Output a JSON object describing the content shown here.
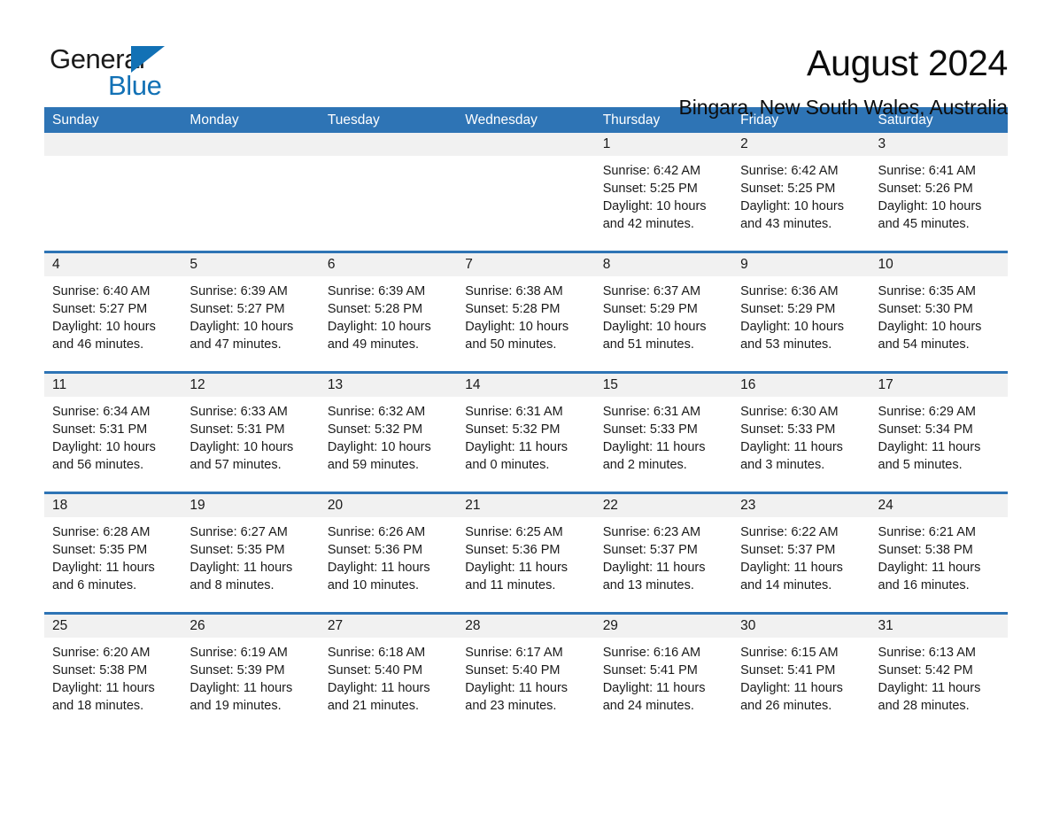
{
  "brand": {
    "word_one": "General",
    "word_two": "Blue",
    "triangle_color": "#1271b5"
  },
  "header": {
    "month_title": "August 2024",
    "location": "Bingara, New South Wales, Australia",
    "accent_color": "#2e74b5"
  },
  "calendar": {
    "weekdays": [
      "Sunday",
      "Monday",
      "Tuesday",
      "Wednesday",
      "Thursday",
      "Friday",
      "Saturday"
    ],
    "weeks": [
      [
        {
          "day": "",
          "lines": []
        },
        {
          "day": "",
          "lines": []
        },
        {
          "day": "",
          "lines": []
        },
        {
          "day": "",
          "lines": []
        },
        {
          "day": "1",
          "lines": [
            "Sunrise: 6:42 AM",
            "Sunset: 5:25 PM",
            "Daylight: 10 hours",
            "and 42 minutes."
          ]
        },
        {
          "day": "2",
          "lines": [
            "Sunrise: 6:42 AM",
            "Sunset: 5:25 PM",
            "Daylight: 10 hours",
            "and 43 minutes."
          ]
        },
        {
          "day": "3",
          "lines": [
            "Sunrise: 6:41 AM",
            "Sunset: 5:26 PM",
            "Daylight: 10 hours",
            "and 45 minutes."
          ]
        }
      ],
      [
        {
          "day": "4",
          "lines": [
            "Sunrise: 6:40 AM",
            "Sunset: 5:27 PM",
            "Daylight: 10 hours",
            "and 46 minutes."
          ]
        },
        {
          "day": "5",
          "lines": [
            "Sunrise: 6:39 AM",
            "Sunset: 5:27 PM",
            "Daylight: 10 hours",
            "and 47 minutes."
          ]
        },
        {
          "day": "6",
          "lines": [
            "Sunrise: 6:39 AM",
            "Sunset: 5:28 PM",
            "Daylight: 10 hours",
            "and 49 minutes."
          ]
        },
        {
          "day": "7",
          "lines": [
            "Sunrise: 6:38 AM",
            "Sunset: 5:28 PM",
            "Daylight: 10 hours",
            "and 50 minutes."
          ]
        },
        {
          "day": "8",
          "lines": [
            "Sunrise: 6:37 AM",
            "Sunset: 5:29 PM",
            "Daylight: 10 hours",
            "and 51 minutes."
          ]
        },
        {
          "day": "9",
          "lines": [
            "Sunrise: 6:36 AM",
            "Sunset: 5:29 PM",
            "Daylight: 10 hours",
            "and 53 minutes."
          ]
        },
        {
          "day": "10",
          "lines": [
            "Sunrise: 6:35 AM",
            "Sunset: 5:30 PM",
            "Daylight: 10 hours",
            "and 54 minutes."
          ]
        }
      ],
      [
        {
          "day": "11",
          "lines": [
            "Sunrise: 6:34 AM",
            "Sunset: 5:31 PM",
            "Daylight: 10 hours",
            "and 56 minutes."
          ]
        },
        {
          "day": "12",
          "lines": [
            "Sunrise: 6:33 AM",
            "Sunset: 5:31 PM",
            "Daylight: 10 hours",
            "and 57 minutes."
          ]
        },
        {
          "day": "13",
          "lines": [
            "Sunrise: 6:32 AM",
            "Sunset: 5:32 PM",
            "Daylight: 10 hours",
            "and 59 minutes."
          ]
        },
        {
          "day": "14",
          "lines": [
            "Sunrise: 6:31 AM",
            "Sunset: 5:32 PM",
            "Daylight: 11 hours",
            "and 0 minutes."
          ]
        },
        {
          "day": "15",
          "lines": [
            "Sunrise: 6:31 AM",
            "Sunset: 5:33 PM",
            "Daylight: 11 hours",
            "and 2 minutes."
          ]
        },
        {
          "day": "16",
          "lines": [
            "Sunrise: 6:30 AM",
            "Sunset: 5:33 PM",
            "Daylight: 11 hours",
            "and 3 minutes."
          ]
        },
        {
          "day": "17",
          "lines": [
            "Sunrise: 6:29 AM",
            "Sunset: 5:34 PM",
            "Daylight: 11 hours",
            "and 5 minutes."
          ]
        }
      ],
      [
        {
          "day": "18",
          "lines": [
            "Sunrise: 6:28 AM",
            "Sunset: 5:35 PM",
            "Daylight: 11 hours",
            "and 6 minutes."
          ]
        },
        {
          "day": "19",
          "lines": [
            "Sunrise: 6:27 AM",
            "Sunset: 5:35 PM",
            "Daylight: 11 hours",
            "and 8 minutes."
          ]
        },
        {
          "day": "20",
          "lines": [
            "Sunrise: 6:26 AM",
            "Sunset: 5:36 PM",
            "Daylight: 11 hours",
            "and 10 minutes."
          ]
        },
        {
          "day": "21",
          "lines": [
            "Sunrise: 6:25 AM",
            "Sunset: 5:36 PM",
            "Daylight: 11 hours",
            "and 11 minutes."
          ]
        },
        {
          "day": "22",
          "lines": [
            "Sunrise: 6:23 AM",
            "Sunset: 5:37 PM",
            "Daylight: 11 hours",
            "and 13 minutes."
          ]
        },
        {
          "day": "23",
          "lines": [
            "Sunrise: 6:22 AM",
            "Sunset: 5:37 PM",
            "Daylight: 11 hours",
            "and 14 minutes."
          ]
        },
        {
          "day": "24",
          "lines": [
            "Sunrise: 6:21 AM",
            "Sunset: 5:38 PM",
            "Daylight: 11 hours",
            "and 16 minutes."
          ]
        }
      ],
      [
        {
          "day": "25",
          "lines": [
            "Sunrise: 6:20 AM",
            "Sunset: 5:38 PM",
            "Daylight: 11 hours",
            "and 18 minutes."
          ]
        },
        {
          "day": "26",
          "lines": [
            "Sunrise: 6:19 AM",
            "Sunset: 5:39 PM",
            "Daylight: 11 hours",
            "and 19 minutes."
          ]
        },
        {
          "day": "27",
          "lines": [
            "Sunrise: 6:18 AM",
            "Sunset: 5:40 PM",
            "Daylight: 11 hours",
            "and 21 minutes."
          ]
        },
        {
          "day": "28",
          "lines": [
            "Sunrise: 6:17 AM",
            "Sunset: 5:40 PM",
            "Daylight: 11 hours",
            "and 23 minutes."
          ]
        },
        {
          "day": "29",
          "lines": [
            "Sunrise: 6:16 AM",
            "Sunset: 5:41 PM",
            "Daylight: 11 hours",
            "and 24 minutes."
          ]
        },
        {
          "day": "30",
          "lines": [
            "Sunrise: 6:15 AM",
            "Sunset: 5:41 PM",
            "Daylight: 11 hours",
            "and 26 minutes."
          ]
        },
        {
          "day": "31",
          "lines": [
            "Sunrise: 6:13 AM",
            "Sunset: 5:42 PM",
            "Daylight: 11 hours",
            "and 28 minutes."
          ]
        }
      ]
    ]
  }
}
